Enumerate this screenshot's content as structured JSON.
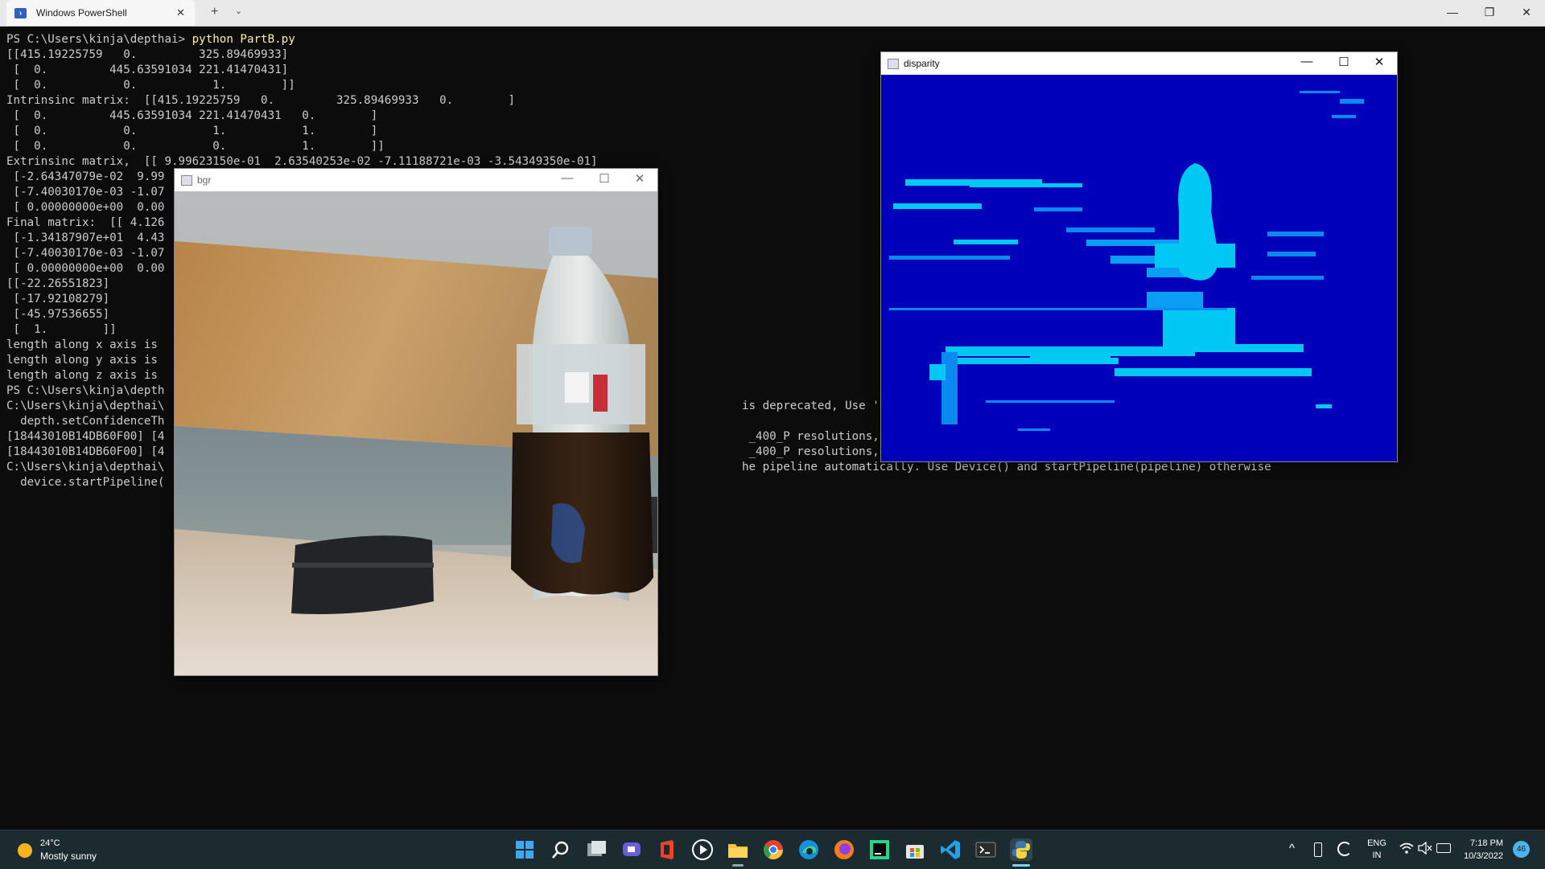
{
  "powershell": {
    "tab_title": "Windows PowerShell",
    "new_tab": "+",
    "dropdown": "⌄",
    "tab_close": "✕",
    "controls": {
      "minimize": "—",
      "maximize": "❐",
      "close": "✕"
    }
  },
  "terminal": {
    "prompt": "PS C:\\Users\\kinja\\depthai> ",
    "command": "python PartB.py",
    "lines": [
      "[[415.19225759   0.         325.89469933]",
      " [  0.         445.63591034 221.41470431]",
      " [  0.           0.           1.        ]]",
      "Intrinsinc matrix:  [[415.19225759   0.         325.89469933   0.        ]",
      " [  0.         445.63591034 221.41470431   0.        ]",
      " [  0.           0.           1.           1.        ]",
      " [  0.           0.           0.           1.        ]]",
      "Extrinsinc matrix,  [[ 9.99623150e-01  2.63540253e-02 -7.11188721e-03 -3.54349350e-01]",
      " [-2.64347079e-02  9.99",
      " [-7.40030170e-03 -1.07",
      " [ 0.00000000e+00  0.00",
      "Final matrix:  [[ 4.126",
      " [-1.34187907e+01  4.43",
      " [-7.40030170e-03 -1.07",
      " [ 0.00000000e+00  0.00",
      "[[-22.26551823]",
      " [-17.92108279]",
      " [-45.97536655]",
      " [  1.        ]]",
      "length along x axis is",
      "length along y axis is",
      "length along z axis is",
      "PS C:\\Users\\kinja\\depth",
      "C:\\Users\\kinja\\depthai\\                                                                                    is deprecated, Use 'initialConf",
      "  depth.setConfidenceTh",
      "[18443010B14DB60F00] [4                                                                                     _400_P resolutions, defaulting",
      "[18443010B14DB60F00] [4                                                                                     _400_P resolutions, defaulting",
      "C:\\Users\\kinja\\depthai\\                                                                                    he pipeline automatically. Use Device() and startPipeline(pipeline) otherwise",
      "  device.startPipeline("
    ]
  },
  "bgr_window": {
    "title": "bgr",
    "controls": {
      "minimize": "—",
      "maximize": "☐",
      "close": "✕"
    }
  },
  "disparity_window": {
    "title": "disparity",
    "controls": {
      "minimize": "—",
      "maximize": "☐",
      "close": "✕"
    }
  },
  "taskbar": {
    "weather_temp": "24°C",
    "weather_desc": "Mostly sunny",
    "lang_top": "ENG",
    "lang_bottom": "IN",
    "time": "7:18 PM",
    "date": "10/3/2022",
    "notification_count": "46",
    "tray_arrow": "^",
    "apps": [
      "start-icon",
      "search-icon",
      "task-view-icon",
      "chat-icon",
      "office-icon",
      "media-player-icon",
      "file-explorer-icon",
      "chrome-icon",
      "edge-icon",
      "firefox-icon",
      "pycharm-icon",
      "store-icon",
      "vscode-icon",
      "terminal-icon",
      "python-icon"
    ]
  },
  "colors": {
    "terminal_bg": "#0c0c0c",
    "terminal_fg": "#cccccc",
    "command": "#f9f1a5",
    "disparity_bg": "#0000bb",
    "disparity_hot": "#00e5ff",
    "taskbar_bg": "#1b2b30"
  }
}
